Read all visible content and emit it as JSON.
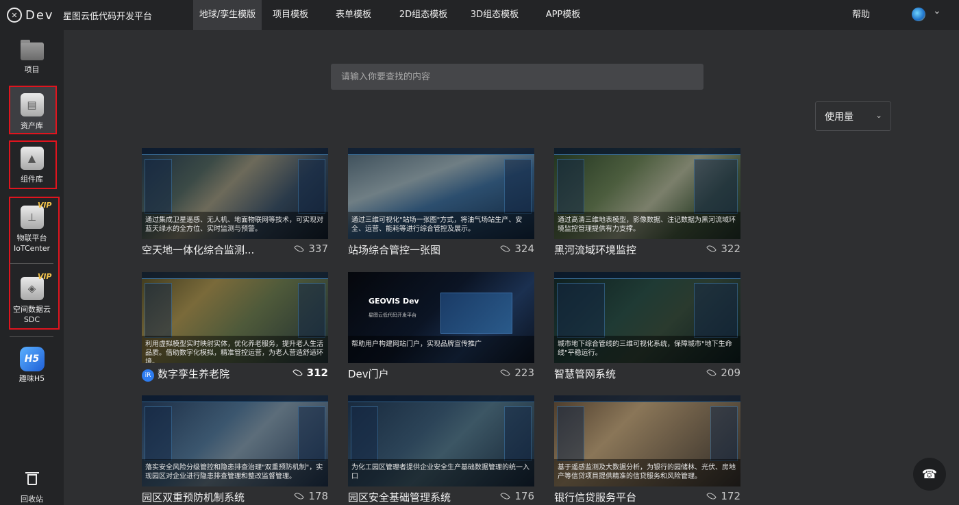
{
  "app": {
    "logo_text": "Dev",
    "title": "星图云低代码开发平台"
  },
  "nav": {
    "items": [
      "地球/孪生模版",
      "项目模板",
      "表单模板",
      "2D组态模板",
      "3D组态模板",
      "APP模板"
    ],
    "active_index": 0,
    "help": "帮助"
  },
  "sidebar": {
    "project": "项目",
    "assets": "资产库",
    "components": "组件库",
    "iot_line1": "物联平台",
    "iot_line2": "IoTCenter",
    "sdc_line1": "空间数据云",
    "sdc_line2": "SDC",
    "h5": "趣味H5",
    "h5_badge": "H5",
    "trash": "回收站",
    "vip_badge": "VIP"
  },
  "search": {
    "placeholder": "请输入你要查找的内容"
  },
  "sort": {
    "selected": "使用量"
  },
  "cards": [
    {
      "title": "空天地一体化综合监测...",
      "views": "337",
      "caption": "通过集成卫星遥感、无人机、地面物联网等技术，可实现对蓝天绿水的全方位、实时监测与预警。"
    },
    {
      "title": "站场综合管控一张图",
      "views": "324",
      "caption": "通过三维可视化\"站场一张图\"方式，将油气场站生产、安全、运营、能耗等进行综合管控及展示。"
    },
    {
      "title": "黑河流域环境监控",
      "views": "322",
      "caption": "通过高清三维地表模型，影像数据、注记数据为黑河流域环境监控管理提供有力支撑。"
    },
    {
      "title": "数字孪生养老院",
      "views": "312",
      "caption": "利用虚拟模型实时映射实体，优化养老服务，提升老人生活品质。借助数字化模拟，精准管控运营，为老人营造舒适环境。"
    },
    {
      "title": "Dev门户",
      "views": "223",
      "caption": "帮助用户构建网站门户，实现品牌宣传推广"
    },
    {
      "title": "智慧管网系统",
      "views": "209",
      "caption": "城市地下综合管线的三维可视化系统，保障城市\"地下生命线\"平稳运行。"
    },
    {
      "title": "园区双重预防机制系统",
      "views": "178",
      "caption": "落实安全风险分级管控和隐患排查治理\"双重预防机制\"，实现园区对企业进行隐患排查管理和整改监督管理。"
    },
    {
      "title": "园区安全基础管理系统",
      "views": "176",
      "caption": "为化工园区管理者提供企业安全生产基础数据管理的统一入口"
    },
    {
      "title": "银行信贷服务平台",
      "views": "172",
      "caption": "基于遥感监测及大数据分析，为银行的园储林、光伏、房地产等信贷项目提供精准的信贷服务和风险管理。"
    }
  ],
  "card4_badge": "iR",
  "geovis": {
    "title": "GEOVIS Dev",
    "subtitle": "星图云低代码开发平台"
  },
  "icons": {
    "logo": "logo-icon",
    "avatar": "avatar-icon",
    "views": "eye-icon",
    "phone": "phone-icon",
    "trash": "trash-icon"
  },
  "colors": {
    "highlight_border": "#e0141e",
    "vip": "#f1c24a"
  }
}
